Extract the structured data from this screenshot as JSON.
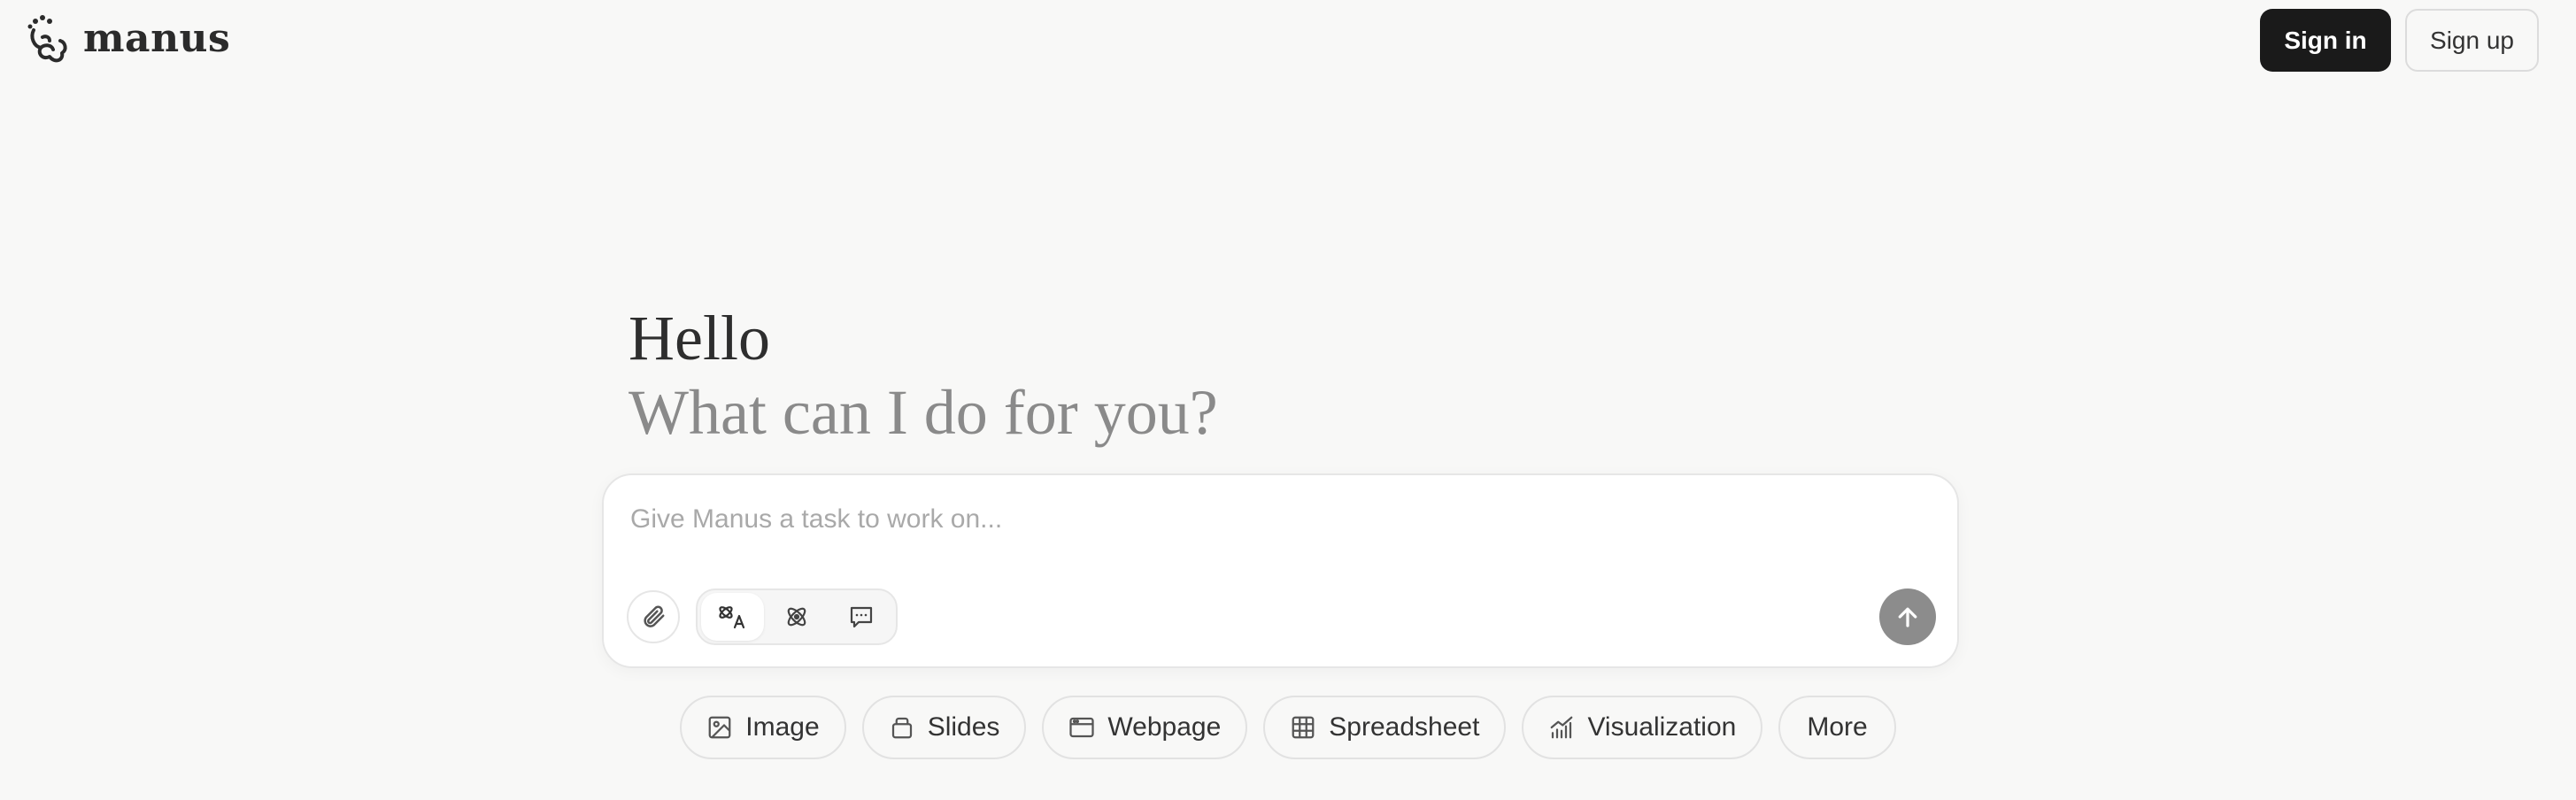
{
  "header": {
    "brand": "manus",
    "sign_in": "Sign in",
    "sign_up": "Sign up"
  },
  "greeting": {
    "hello": "Hello",
    "question": "What can I do for you?"
  },
  "composer": {
    "placeholder": "Give Manus a task to work on...",
    "modes": [
      "agent-mode-icon",
      "atom-mode-icon",
      "chat-mode-icon"
    ],
    "active_mode": 0
  },
  "chips": [
    {
      "label": "Image",
      "icon": "image-icon"
    },
    {
      "label": "Slides",
      "icon": "slides-icon"
    },
    {
      "label": "Webpage",
      "icon": "webpage-icon"
    },
    {
      "label": "Spreadsheet",
      "icon": "spreadsheet-icon"
    },
    {
      "label": "Visualization",
      "icon": "visualization-icon"
    },
    {
      "label": "More",
      "icon": ""
    }
  ],
  "colors": {
    "background": "#f8f8f7",
    "primary_button": "#1a1a1a",
    "send_button": "#8c8c8c"
  }
}
